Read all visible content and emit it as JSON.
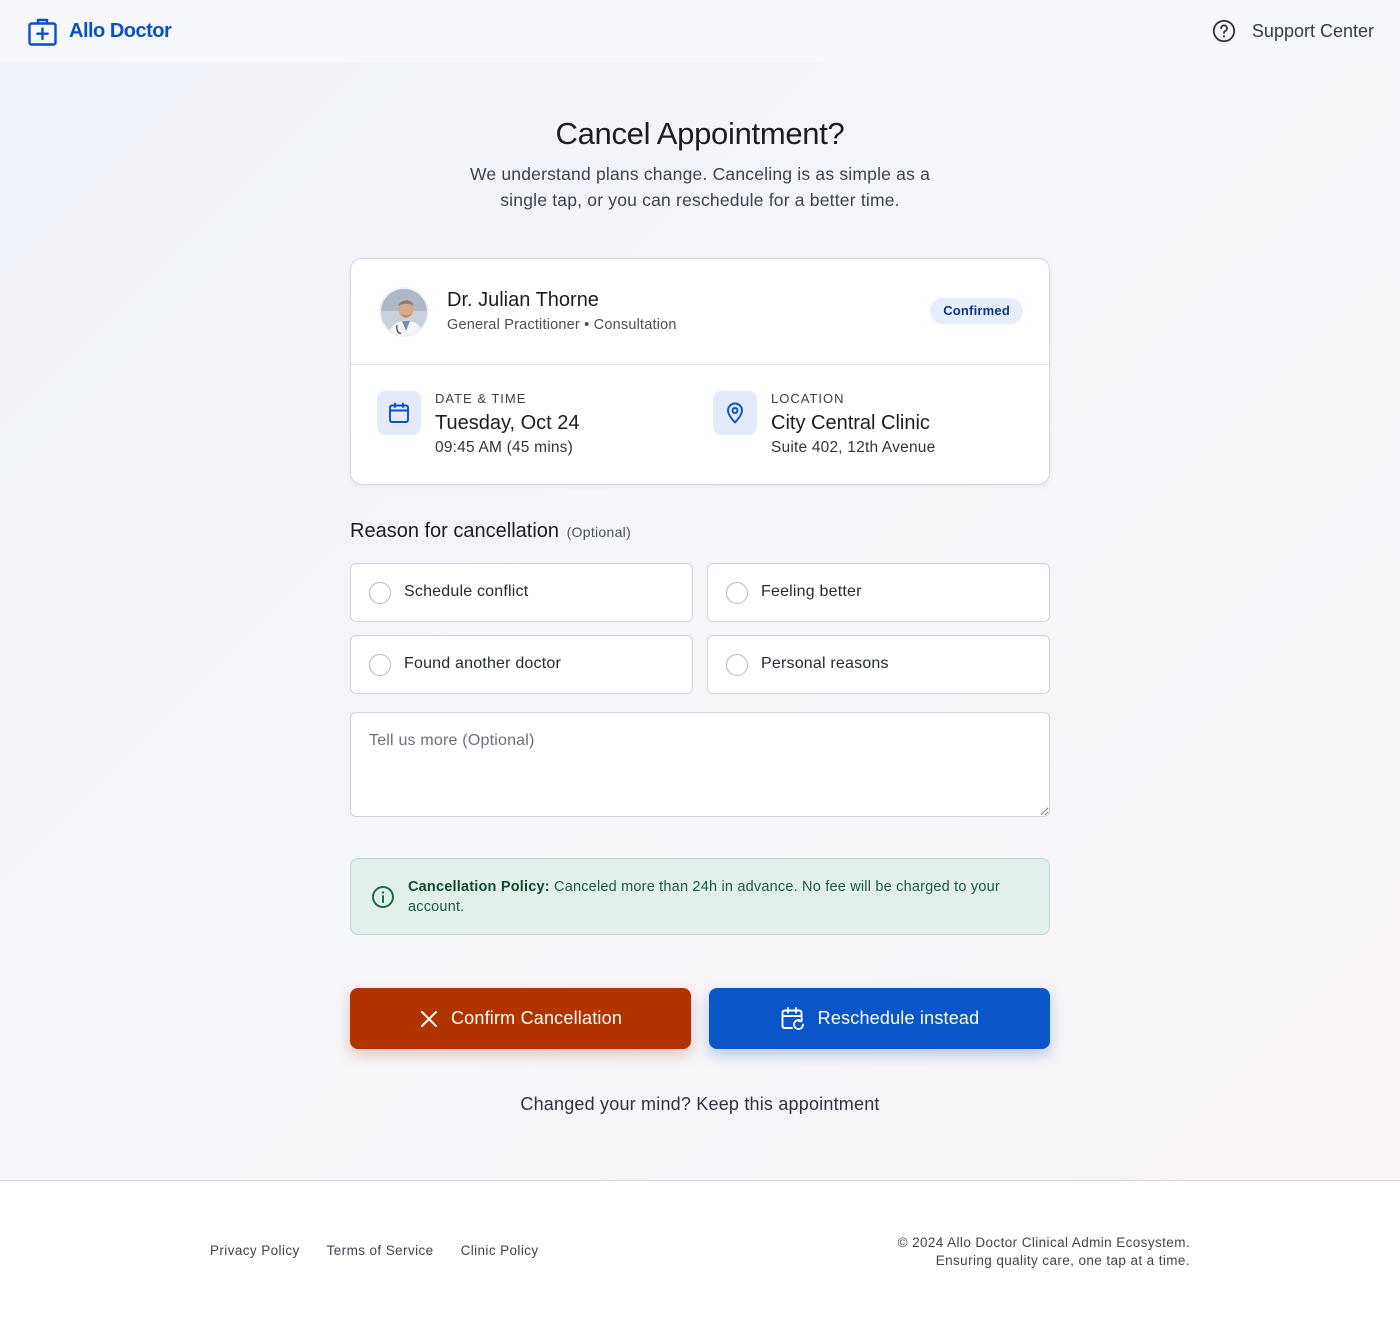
{
  "header": {
    "brand": "Allo Doctor",
    "support_label": "Support Center"
  },
  "page": {
    "title": "Cancel Appointment?",
    "subtitle": "We understand plans change. Canceling is as simple as a single tap, or you can reschedule for a better time."
  },
  "appointment": {
    "doctor_name": "Dr. Julian Thorne",
    "doctor_meta": "General Practitioner • Consultation",
    "status": "Confirmed",
    "datetime_label": "DATE & TIME",
    "date": "Tuesday, Oct 24",
    "time": "09:45 AM (45 mins)",
    "location_label": "LOCATION",
    "location_name": "City Central Clinic",
    "location_address": "Suite 402, 12th Avenue"
  },
  "reason": {
    "title": "Reason for cancellation",
    "optional": "(Optional)",
    "options": [
      "Schedule conflict",
      "Feeling better",
      "Found another doctor",
      "Personal reasons"
    ],
    "textarea_placeholder": "Tell us more (Optional)"
  },
  "policy": {
    "label": "Cancellation Policy:",
    "text": " Canceled more than 24h in advance. No fee will be charged to your account."
  },
  "actions": {
    "confirm_label": "Confirm Cancellation",
    "reschedule_label": "Reschedule instead",
    "keep_label": "Changed your mind? Keep this appointment"
  },
  "footer": {
    "links": [
      "Privacy Policy",
      "Terms of Service",
      "Clinic Policy"
    ],
    "copyright_line1": "© 2024 Allo Doctor Clinical Admin Ecosystem.",
    "copyright_line2": "Ensuring quality care, one tap at a time."
  },
  "colors": {
    "brand": "#0a4fc4",
    "danger": "#b03300",
    "primary": "#0b55c8",
    "success_bg": "#e2efeb"
  }
}
